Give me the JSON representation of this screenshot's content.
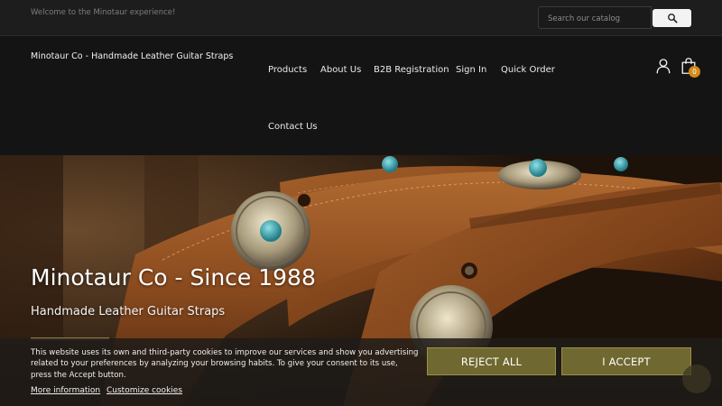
{
  "topbar": {
    "welcome": "Welcome to the Minotaur experience!",
    "search_placeholder": "Search our catalog"
  },
  "header": {
    "brand": "Minotaur Co - Handmade Leather Guitar Straps",
    "nav": [
      "Products",
      "About Us",
      "B2B Registration",
      "Sign In",
      "Quick Order",
      "Contact Us"
    ],
    "cart_count": "0"
  },
  "hero": {
    "title": "Minotaur Co - Since 1988",
    "subtitle": "Handmade Leather Guitar Straps"
  },
  "cookie": {
    "text": "This website uses its own and third-party cookies to improve our services and show you advertising related to your preferences by analyzing your browsing habits. To give your consent to its use, press the Accept button.",
    "more_info": "More information",
    "customize": "Customize cookies",
    "reject": "REJECT ALL",
    "accept": "I ACCEPT"
  },
  "colors": {
    "accent_button": "#6f6830",
    "cart_badge": "#d38a17"
  }
}
